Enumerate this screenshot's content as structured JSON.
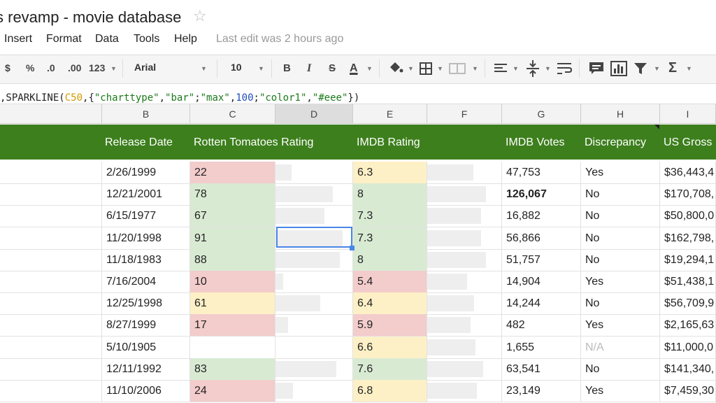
{
  "doc": {
    "title": "s revamp - movie database"
  },
  "menu": {
    "items": [
      "Insert",
      "Format",
      "Data",
      "Tools",
      "Help"
    ],
    "last_edit": "Last edit was 2 hours ago"
  },
  "toolbar": {
    "currency": "$",
    "percent": "%",
    "dec_less": ".0",
    "dec_more": ".00",
    "more_formats": "123",
    "font": "Arial",
    "size": "10",
    "bold": "B",
    "italic": "I",
    "strike": "S",
    "text_color": "A"
  },
  "formula": {
    "p1": ",SPARKLINE(",
    "ref": "C50",
    "p2": ",{",
    "s1": "\"charttype\"",
    "p3": ",",
    "s2": "\"bar\"",
    "p4": ";",
    "s3": "\"max\"",
    "p5": ",",
    "n1": "100",
    "p6": ";",
    "s4": "\"color1\"",
    "p7": ",",
    "s5": "\"#eee\"",
    "p8": "})"
  },
  "columns": [
    "B",
    "C",
    "D",
    "E",
    "F",
    "G",
    "H",
    "I"
  ],
  "header": {
    "release": "Release Date",
    "rt": "Rotten Tomatoes Rating",
    "imdb": "IMDB Rating",
    "votes": "IMDB Votes",
    "disc": "Discrepancy",
    "gross": "US Gross"
  },
  "rows": [
    {
      "date": "2/26/1999",
      "rt": "22",
      "rt_color": "red",
      "rt_bar": 22,
      "imdb": "6.3",
      "imdb_color": "yellow",
      "imdb_bar": 63,
      "votes": "47,753",
      "disc": "Yes",
      "gross": "$36,443,4"
    },
    {
      "date": "12/21/2001",
      "rt": "78",
      "rt_color": "green",
      "rt_bar": 78,
      "imdb": "8",
      "imdb_color": "green",
      "imdb_bar": 80,
      "votes": "126,067",
      "votes_bold": true,
      "disc": "No",
      "gross": "$170,708,"
    },
    {
      "date": "6/15/1977",
      "rt": "67",
      "rt_color": "green",
      "rt_bar": 67,
      "imdb": "7.3",
      "imdb_color": "green",
      "imdb_bar": 73,
      "votes": "16,882",
      "disc": "No",
      "gross": "$50,800,0"
    },
    {
      "date": "11/20/1998",
      "rt": "91",
      "rt_color": "green",
      "rt_bar": 91,
      "imdb": "7.3",
      "imdb_color": "green",
      "imdb_bar": 73,
      "votes": "56,866",
      "disc": "No",
      "gross": "$162,798,"
    },
    {
      "date": "11/18/1983",
      "rt": "88",
      "rt_color": "green",
      "rt_bar": 88,
      "imdb": "8",
      "imdb_color": "green",
      "imdb_bar": 80,
      "votes": "51,757",
      "disc": "No",
      "gross": "$19,294,1"
    },
    {
      "date": "7/16/2004",
      "rt": "10",
      "rt_color": "red",
      "rt_bar": 10,
      "imdb": "5.4",
      "imdb_color": "red",
      "imdb_bar": 54,
      "votes": "14,904",
      "disc": "Yes",
      "gross": "$51,438,1"
    },
    {
      "date": "12/25/1998",
      "rt": "61",
      "rt_color": "yellow",
      "rt_bar": 61,
      "imdb": "6.4",
      "imdb_color": "yellow",
      "imdb_bar": 64,
      "votes": "14,244",
      "disc": "No",
      "gross": "$56,709,9"
    },
    {
      "date": "8/27/1999",
      "rt": "17",
      "rt_color": "red",
      "rt_bar": 17,
      "imdb": "5.9",
      "imdb_color": "red",
      "imdb_bar": 59,
      "votes": "482",
      "disc": "Yes",
      "gross": "$2,165,63"
    },
    {
      "date": "5/10/1905",
      "rt": "",
      "rt_color": "none",
      "rt_bar": 0,
      "imdb": "6.6",
      "imdb_color": "yellow",
      "imdb_bar": 66,
      "votes": "1,655",
      "disc": "N/A",
      "disc_na": true,
      "gross": "$11,000,0"
    },
    {
      "date": "12/11/1992",
      "rt": "83",
      "rt_color": "green",
      "rt_bar": 83,
      "imdb": "7.6",
      "imdb_color": "green",
      "imdb_bar": 76,
      "votes": "63,541",
      "disc": "No",
      "gross": "$141,340,"
    },
    {
      "date": "11/10/2006",
      "rt": "24",
      "rt_color": "red",
      "rt_bar": 24,
      "imdb": "6.8",
      "imdb_color": "yellow",
      "imdb_bar": 68,
      "votes": "23,149",
      "disc": "Yes",
      "gross": "$7,459,30"
    }
  ]
}
